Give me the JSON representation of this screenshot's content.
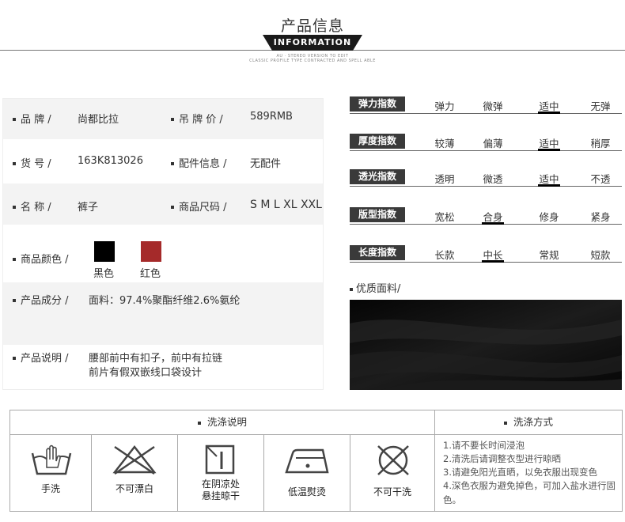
{
  "header": {
    "title": "产品信息",
    "badge": "INFORMATION",
    "sub_line1": "AU · STEREO VERSION TO EDIT",
    "sub_line2": "CLASSIC PROFILE TYPE CONTRACTED AND SPELL ABLE"
  },
  "info": {
    "brand_label": "品 牌 /",
    "brand_value": "尚都比拉",
    "price_label": "吊 牌 价 /",
    "price_value": "589RMB",
    "code_label": "货 号 /",
    "code_value": "163K813026",
    "accessory_label": "配件信息 /",
    "accessory_value": "无配件",
    "name_label": "名 称 /",
    "name_value": "裤子",
    "size_label": "商品尺码 /",
    "size_value": "S M L XL XXL",
    "color_label": "商品颜色 /",
    "colors": [
      {
        "name": "黑色",
        "hex": "#000000"
      },
      {
        "name": "红色",
        "hex": "#a52a2a"
      }
    ],
    "material_label": "产品成分 /",
    "material_value": "面料：97.4%聚酯纤维2.6%氨纶",
    "desc_label": "产品说明 /",
    "desc_line1": "腰部前中有扣子，前中有拉链",
    "desc_line2": "前片有假双嵌线口袋设计"
  },
  "indices": [
    {
      "label": "弹力指数",
      "options": [
        "弹力",
        "微弹",
        "适中",
        "无弹"
      ],
      "selected": 2
    },
    {
      "label": "厚度指数",
      "options": [
        "较薄",
        "偏薄",
        "适中",
        "稍厚"
      ],
      "selected": 2
    },
    {
      "label": "透光指数",
      "options": [
        "透明",
        "微透",
        "适中",
        "不透"
      ],
      "selected": 2
    },
    {
      "label": "版型指数",
      "options": [
        "宽松",
        "合身",
        "修身",
        "紧身"
      ],
      "selected": 1
    },
    {
      "label": "长度指数",
      "options": [
        "长款",
        "中长",
        "常规",
        "短款"
      ],
      "selected": 1
    }
  ],
  "fabric": {
    "title": "优质面料/"
  },
  "care": {
    "wash_header": "洗涤说明",
    "method_header": "洗涤方式",
    "icons": [
      {
        "icon": "hand-wash-icon",
        "label1": "手洗",
        "label2": ""
      },
      {
        "icon": "no-bleach-icon",
        "label1": "不可漂白",
        "label2": ""
      },
      {
        "icon": "shade-dry-icon",
        "label1": "在阴凉处",
        "label2": "悬挂晾干"
      },
      {
        "icon": "low-iron-icon",
        "label1": "低温熨烫",
        "label2": ""
      },
      {
        "icon": "no-dry-clean-icon",
        "label1": "不可干洗",
        "label2": ""
      }
    ],
    "rules": [
      "1.请不要长时间浸泡",
      "2.清洗后请调整衣型进行晾晒",
      "3.请避免阳光直晒，以免衣服出现变色",
      "4.深色衣服为避免掉色，可加入盐水进行固色。"
    ]
  }
}
